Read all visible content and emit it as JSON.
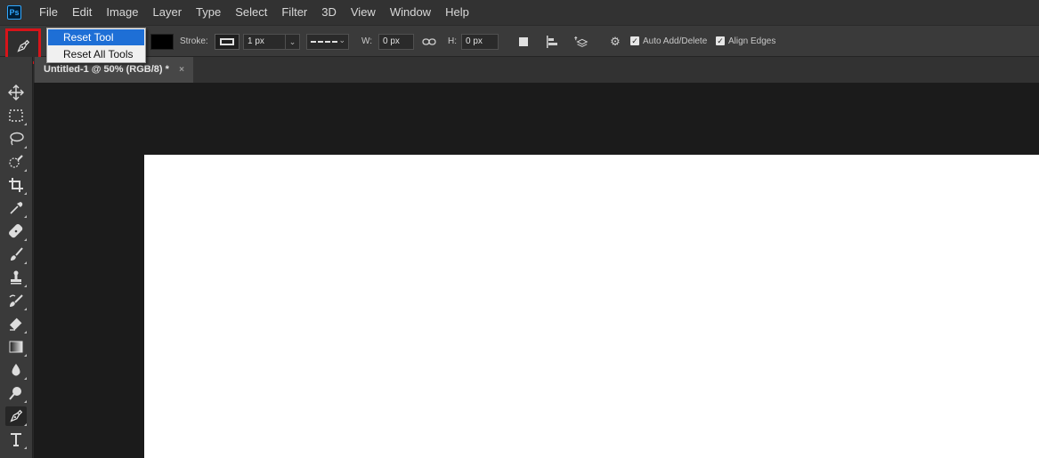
{
  "app": {
    "logo_text": "Ps"
  },
  "menubar": {
    "items": [
      "File",
      "Edit",
      "Image",
      "Layer",
      "Type",
      "Select",
      "Filter",
      "3D",
      "View",
      "Window",
      "Help"
    ]
  },
  "options": {
    "stroke_label": "Stroke:",
    "stroke_width": "1 px",
    "w_label": "W:",
    "w_value": "0 px",
    "h_label": "H:",
    "h_value": "0 px",
    "auto_add_delete_label": "Auto Add/Delete",
    "auto_add_delete_checked": true,
    "align_edges_label": "Align Edges",
    "align_edges_checked": true,
    "fill_color": "#000000"
  },
  "reset_menu": {
    "items": [
      {
        "label": "Reset Tool",
        "selected": true
      },
      {
        "label": "Reset All Tools",
        "selected": false
      }
    ]
  },
  "document": {
    "tab_title": "Untitled-1 @ 50% (RGB/8) *",
    "close_glyph": "×"
  },
  "toolbar": {
    "tools": [
      "move-tool",
      "marquee-tool",
      "lasso-tool",
      "quick-selection-tool",
      "crop-tool",
      "eyedropper-tool",
      "healing-brush-tool",
      "brush-tool",
      "clone-stamp-tool",
      "history-brush-tool",
      "eraser-tool",
      "gradient-tool",
      "blur-tool",
      "dodge-tool",
      "pen-tool",
      "type-tool"
    ],
    "active_tool": "pen-tool"
  },
  "colors": {
    "highlight_border": "#d7141a",
    "menu_selected": "#1e6fd6",
    "canvas": "#ffffff"
  }
}
